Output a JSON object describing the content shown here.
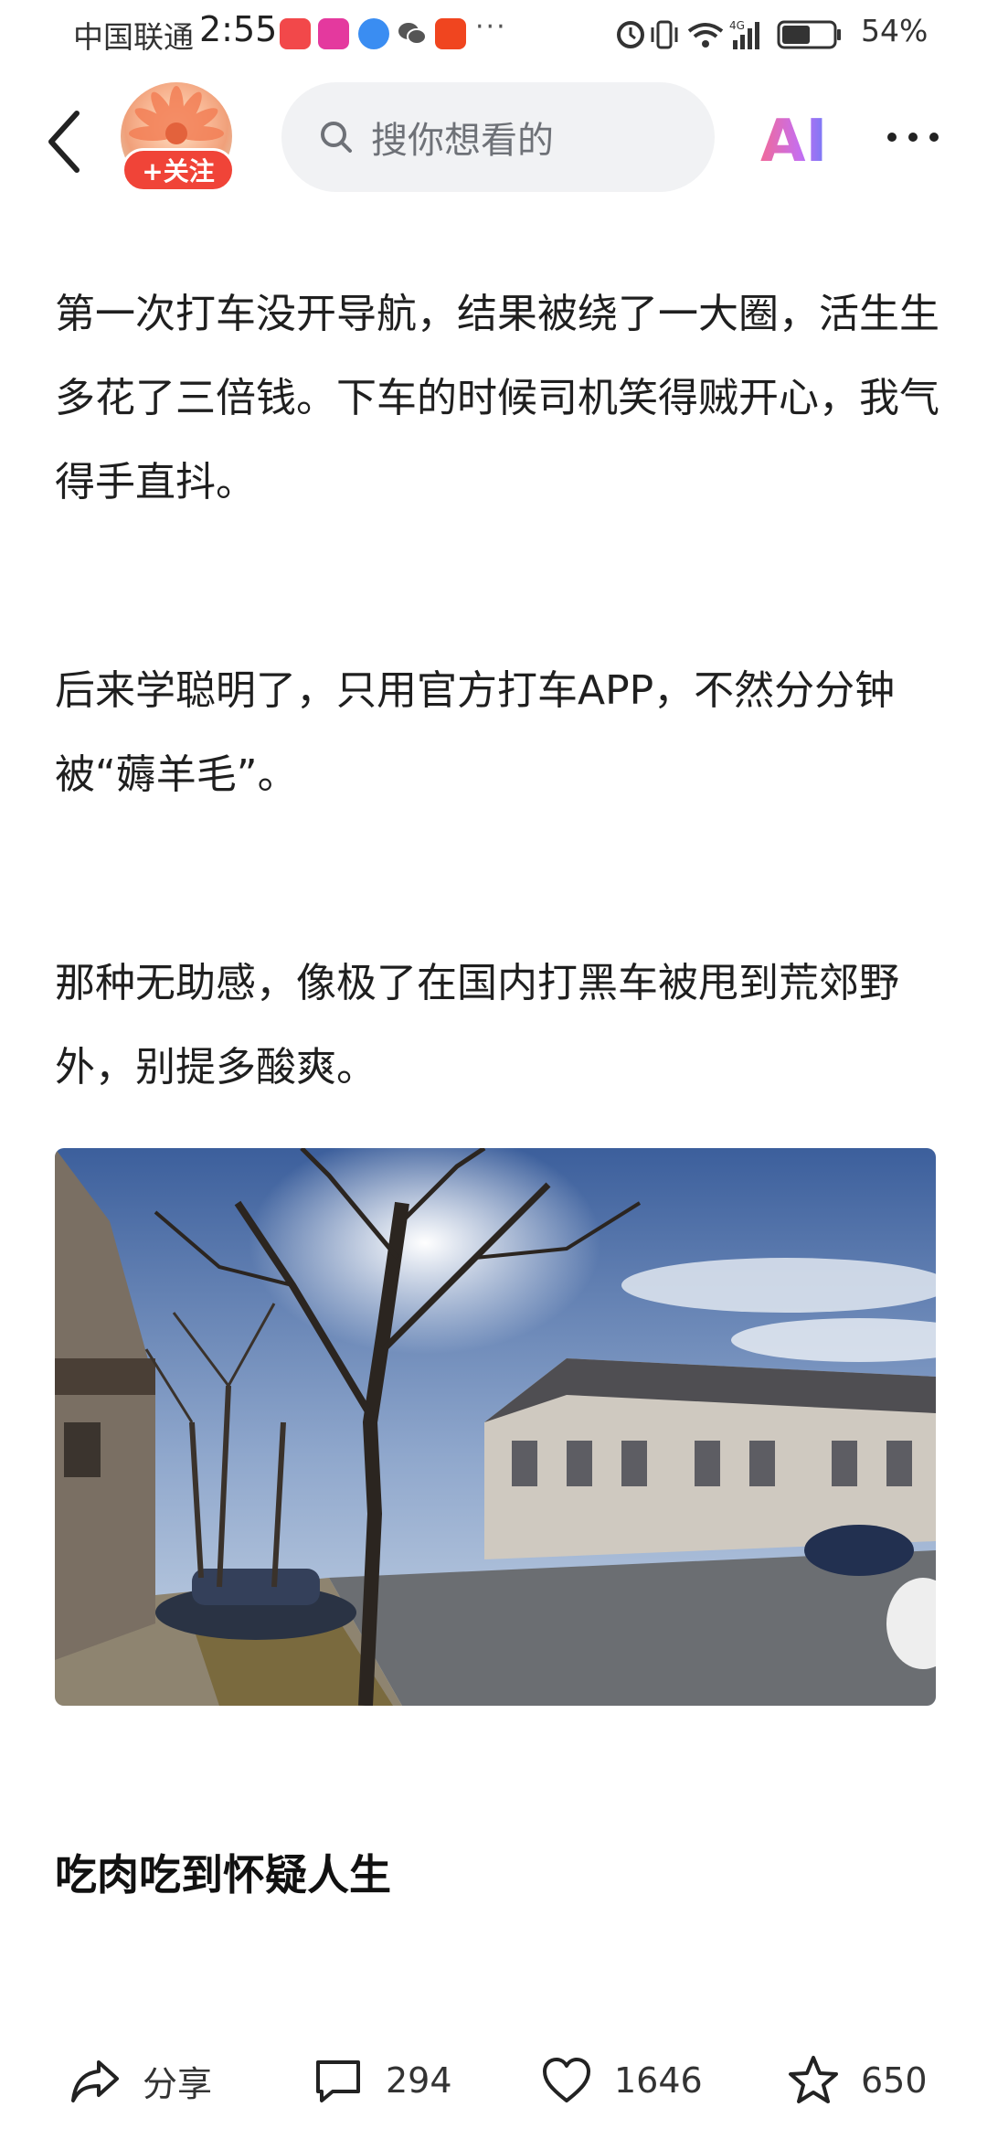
{
  "status_bar": {
    "carrier": "中国联通",
    "time": "2:55",
    "network": "4G",
    "battery_pct": "54%",
    "notification_icons": [
      "huawei-store-icon",
      "notes-icon",
      "browser-icon",
      "wechat-icon",
      "taobao-icon"
    ],
    "more": "···"
  },
  "nav": {
    "follow_label": "+关注",
    "search_placeholder": "搜你想看的",
    "ai_label": "AI"
  },
  "article": {
    "paragraphs": [
      "第一次打车没开导航，结果被绕了一大圈，活生生多花了三倍钱。下车的时候司机笑得贼开心，我气得手直抖。",
      "后来学聪明了，只用官方打车APP，不然分分钟被“薅羊毛”。",
      "那种无助感，像极了在国内打黑车被甩到荒郊野外，别提多酸爽。"
    ],
    "section_heading": "吃肉吃到怀疑人生"
  },
  "actions": {
    "share_label": "分享",
    "comments": "294",
    "likes": "1646",
    "favorites": "650"
  },
  "colors": {
    "follow_red": "#f04438",
    "search_bg": "#f1f2f4",
    "ai_gradient_start": "#f06a9a",
    "ai_gradient_end": "#6f7bf7"
  }
}
